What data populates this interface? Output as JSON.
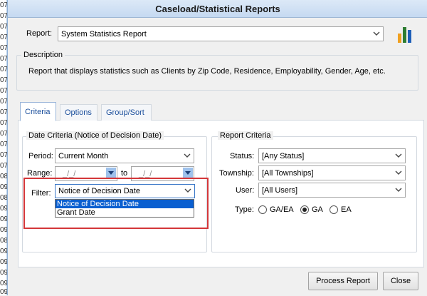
{
  "window": {
    "title": "Caseload/Statistical Reports"
  },
  "gutter_numbers": [
    "07",
    "07",
    "07",
    "07",
    "07",
    "07",
    "07",
    "07",
    "07",
    "07",
    "07",
    "07",
    "07",
    "07",
    "07",
    "07",
    "08",
    "09",
    "08",
    "09",
    "09",
    "09",
    "08",
    "09",
    "09",
    "09",
    "09",
    "09"
  ],
  "report": {
    "label": "Report:",
    "value": "System Statistics Report",
    "icon": "bar-chart-icon"
  },
  "description": {
    "legend": "Description",
    "text": "Report that displays statistics such as Clients by Zip Code, Residence, Employability, Gender, Age, etc."
  },
  "tabs": [
    {
      "label": "Criteria",
      "active": true
    },
    {
      "label": "Options",
      "active": false
    },
    {
      "label": "Group/Sort",
      "active": false
    }
  ],
  "date_criteria": {
    "legend": "Date Criteria (Notice of Decision Date)",
    "period_label": "Period:",
    "period_value": "Current Month",
    "range_label": "Range:",
    "range_from": "_/_/",
    "range_to_label": "to",
    "range_to": "_/_/",
    "filter_label": "Filter:",
    "filter_value": "Notice of Decision Date",
    "filter_options": [
      "Notice of Decision Date",
      "Grant Date"
    ],
    "filter_selected_option": 0
  },
  "report_criteria": {
    "legend": "Report Criteria",
    "status_label": "Status:",
    "status_value": "[Any Status]",
    "township_label": "Township:",
    "township_value": "[All Townships]",
    "user_label": "User:",
    "user_value": "[All Users]",
    "type_label": "Type:",
    "type_options": [
      {
        "label": "GA/EA",
        "checked": false
      },
      {
        "label": "GA",
        "checked": true
      },
      {
        "label": "EA",
        "checked": false
      }
    ]
  },
  "buttons": {
    "process": "Process Report",
    "close": "Close"
  },
  "colors": {
    "highlight_box": "#d4373a",
    "selection": "#0a5fd0",
    "tab_text": "#1b4f9c"
  }
}
